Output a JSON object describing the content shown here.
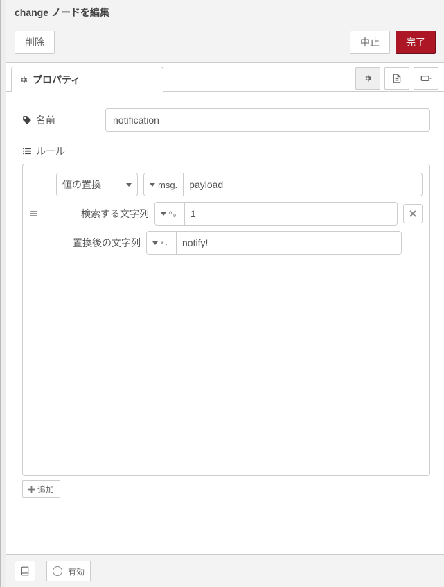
{
  "header": {
    "title": "change ノードを編集",
    "delete_label": "削除",
    "cancel_label": "中止",
    "done_label": "完了"
  },
  "tabs": {
    "properties_label": "プロパティ"
  },
  "form": {
    "name_label": "名前",
    "name_value": "notification",
    "rules_label": "ルール"
  },
  "rule": {
    "action_label": "値の置換",
    "target_type_label": "msg.",
    "target_value": "payload",
    "search_label": "検索する文字列",
    "search_type_icon": "num",
    "search_value": "1",
    "replace_label": "置換後の文字列",
    "replace_type_icon": "str",
    "replace_value": "notify!"
  },
  "buttons": {
    "add_label": "追加",
    "enabled_label": "有効"
  }
}
